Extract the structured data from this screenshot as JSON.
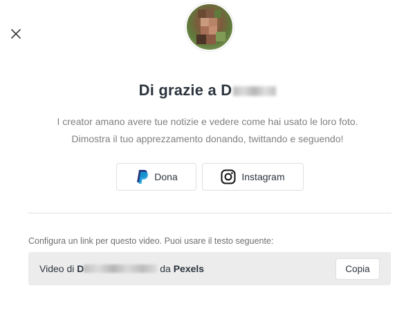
{
  "modal": {
    "close_icon": "close-icon",
    "title_prefix": "Di grazie a D",
    "description_line1": "I creator amano avere tue notizie e vedere come hai usato le loro foto.",
    "description_line2": "Dimostra il tuo apprezzamento donando, twittando e seguendo!",
    "actions": [
      {
        "label": "Dona",
        "icon": "paypal-icon"
      },
      {
        "label": "Instagram",
        "icon": "instagram-icon"
      }
    ],
    "config_label": "Configura un link per questo video. Puoi usare il testo seguente:",
    "credit": {
      "prefix": "Video di ",
      "name_start": "D",
      "middle": " da ",
      "source": "Pexels",
      "copy_label": "Copia"
    }
  },
  "colors": {
    "text": "#2c343e",
    "muted": "#7f7f7f",
    "border": "#dfdfe0",
    "credit_bg": "#ececec",
    "paypal_dark": "#253b80",
    "paypal_light": "#179bd7"
  }
}
